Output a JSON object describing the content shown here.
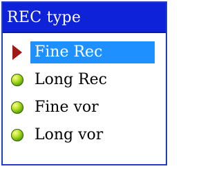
{
  "window": {
    "title": "REC type"
  },
  "menu": {
    "items": [
      {
        "label": "Fine Rec",
        "selected": true,
        "marker": "selection-arrow-icon"
      },
      {
        "label": "Long Rec",
        "selected": false,
        "marker": "green-bullet-icon"
      },
      {
        "label": "Fine vor",
        "selected": false,
        "marker": "green-bullet-icon"
      },
      {
        "label": "Long vor",
        "selected": false,
        "marker": "green-bullet-icon"
      }
    ]
  },
  "colors": {
    "title_bar": "#0e22d8",
    "frame_border": "#1f3ec8",
    "selection_highlight": "#1e90ff",
    "selection_arrow": "#a01818",
    "bullet": "#5aa010"
  }
}
